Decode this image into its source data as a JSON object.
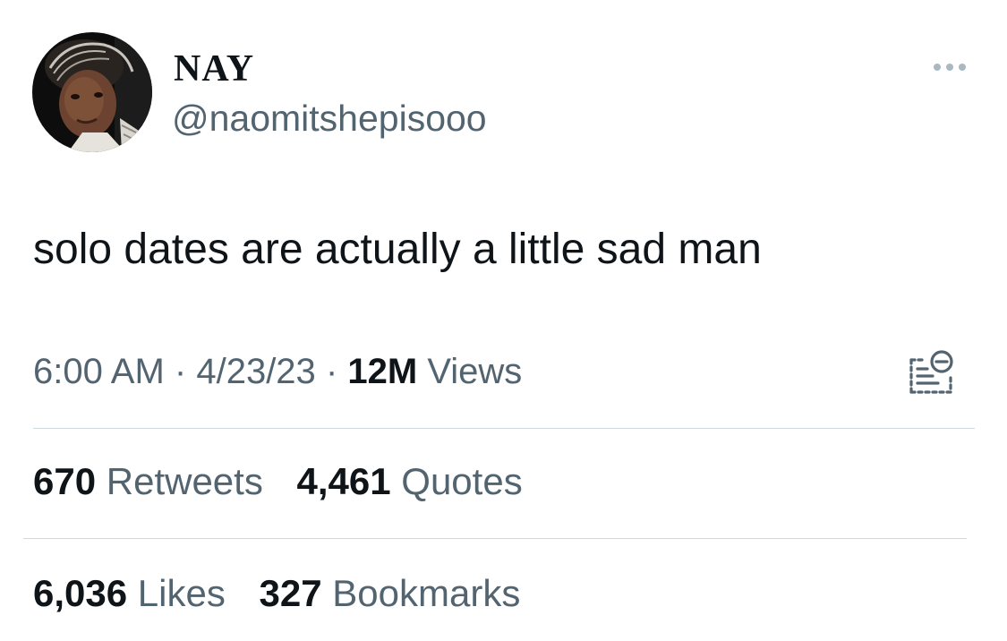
{
  "author": {
    "display_name": "NAY",
    "handle": "@naomitshepisooo",
    "avatar_icon": "profile-photo"
  },
  "tweet": {
    "text": "solo dates are actually a little sad man"
  },
  "meta": {
    "time": "6:00 AM",
    "sep1": "·",
    "date": "4/23/23",
    "sep2": "·",
    "views_count": "12M",
    "views_label": "Views"
  },
  "stats": {
    "retweets": {
      "count": "670",
      "label": "Retweets"
    },
    "quotes": {
      "count": "4,461",
      "label": "Quotes"
    },
    "likes": {
      "count": "6,036",
      "label": "Likes"
    },
    "bookmarks": {
      "count": "327",
      "label": "Bookmarks"
    }
  },
  "icons": {
    "more": "more-horizontal-icon",
    "analytics": "analytics-remove-icon"
  },
  "colors": {
    "text_primary": "#0f1419",
    "text_secondary": "#536471",
    "divider": "#cfd9de"
  }
}
